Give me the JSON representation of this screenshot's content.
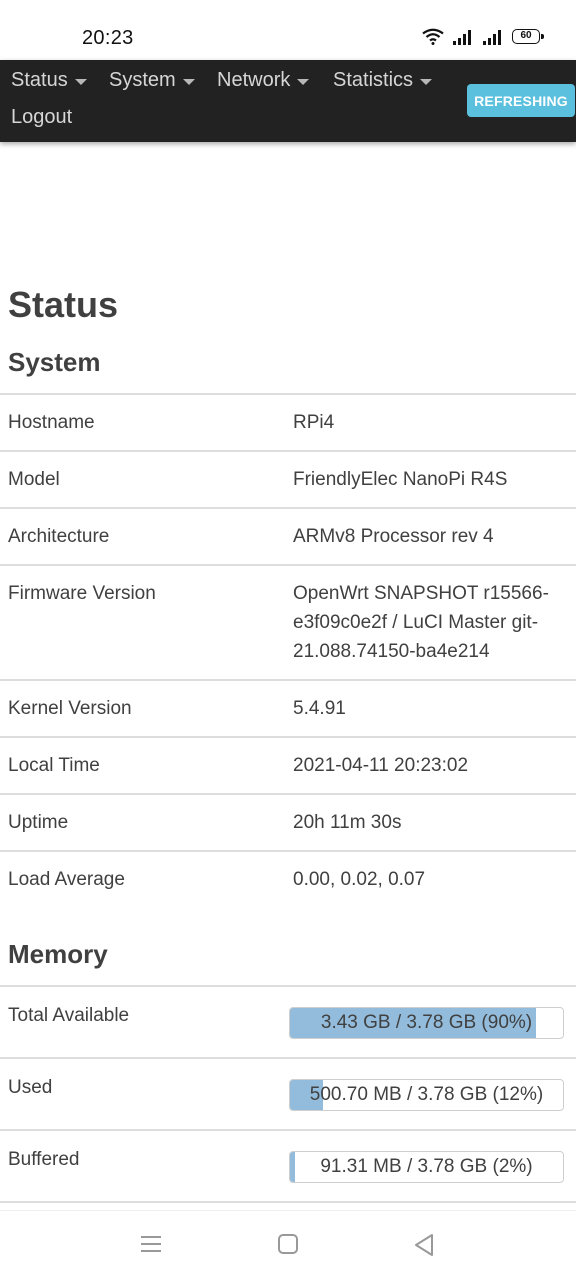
{
  "statusbar": {
    "time": "20:23",
    "battery": "60"
  },
  "nav": {
    "items": [
      {
        "label": "Status"
      },
      {
        "label": "System"
      },
      {
        "label": "Network"
      },
      {
        "label": "Statistics"
      }
    ],
    "logout": "Logout",
    "refreshing": "REFRESHING"
  },
  "page_title": "Status",
  "system": {
    "title": "System",
    "rows": [
      {
        "key": "Hostname",
        "value": "RPi4"
      },
      {
        "key": "Model",
        "value": "FriendlyElec NanoPi R4S"
      },
      {
        "key": "Architecture",
        "value": "ARMv8 Processor rev 4"
      },
      {
        "key": "Firmware Version",
        "value": "OpenWrt SNAPSHOT r15566-e3f09c0e2f / LuCI Master git-21.088.74150-ba4e214"
      },
      {
        "key": "Kernel Version",
        "value": "5.4.91"
      },
      {
        "key": "Local Time",
        "value": "2021-04-11 20:23:02"
      },
      {
        "key": "Uptime",
        "value": "20h 11m 30s"
      },
      {
        "key": "Load Average",
        "value": "0.00, 0.02, 0.07"
      }
    ]
  },
  "memory": {
    "title": "Memory",
    "rows": [
      {
        "key": "Total Available",
        "value": "3.43 GB / 3.78 GB (90%)",
        "percent": 90
      },
      {
        "key": "Used",
        "value": "500.70 MB / 3.78 GB (12%)",
        "percent": 12
      },
      {
        "key": "Buffered",
        "value": "91.31 MB / 3.78 GB (2%)",
        "percent": 2
      }
    ]
  },
  "colors": {
    "navbar": "#222222",
    "refresh": "#5bc0de",
    "bar_fill": "#93bcdc"
  }
}
